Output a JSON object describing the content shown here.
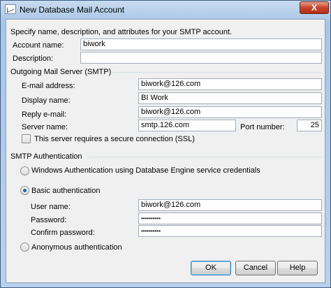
{
  "window": {
    "title": "New Database Mail Account",
    "close_label": "X"
  },
  "intro": "Specify name, description, and attributes for your SMTP account.",
  "account": {
    "name_label": "Account name:",
    "name_value": "biwork",
    "description_label": "Description:",
    "description_value": ""
  },
  "outgoing": {
    "group_label": "Outgoing Mail Server (SMTP)",
    "email_label": "E-mail address:",
    "email_value": "biwork@126.com",
    "display_label": "Display name:",
    "display_value": "BI Work",
    "reply_label": "Reply e-mail:",
    "reply_value": "biwork@126.com",
    "server_label": "Server name:",
    "server_value": "smtp.126.com",
    "port_label": "Port number:",
    "port_value": "25",
    "ssl_label": "This server requires a secure connection (SSL)",
    "ssl_checked": false
  },
  "auth": {
    "group_label": "SMTP Authentication",
    "windows_label": "Windows Authentication using Database Engine service credentials",
    "basic_label": "Basic authentication",
    "selected": "basic",
    "user_label": "User name:",
    "user_value": "biwork@126.com",
    "password_label": "Password:",
    "password_value": "••••••••••",
    "confirm_label": "Confirm password:",
    "confirm_value": "••••••••••",
    "anonymous_label": "Anonymous authentication"
  },
  "buttons": {
    "ok": "OK",
    "cancel": "Cancel",
    "help": "Help"
  }
}
